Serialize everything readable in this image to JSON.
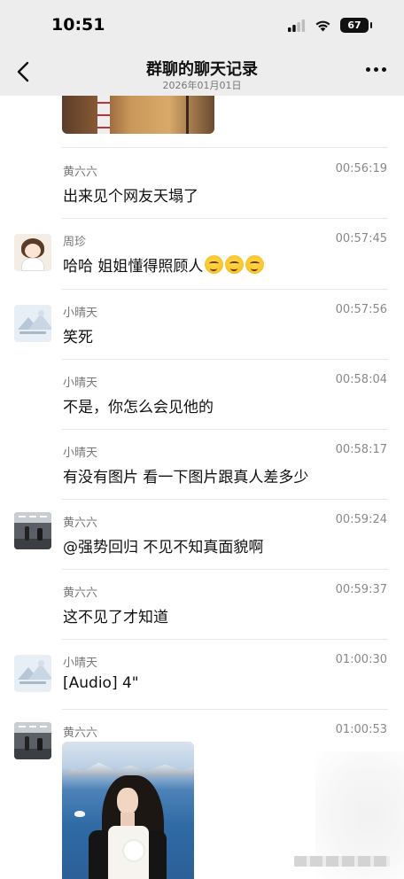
{
  "status_bar": {
    "time": "10:51",
    "battery": "67"
  },
  "header": {
    "title": "群聊的聊天记录",
    "subtitle": "2026年01月01日"
  },
  "messages": [
    {
      "sender": "黄六六",
      "time": "00:56:19",
      "text": "出来见个网友天塌了"
    },
    {
      "sender": "周珍",
      "time": "00:57:45",
      "text": "哈哈 姐姐懂得照顾人",
      "emoji_count": 3,
      "emoji_icon": "grimace-emoji-icon"
    },
    {
      "sender": "小晴天",
      "time": "00:57:56",
      "text": "笑死"
    },
    {
      "sender": "小晴天",
      "time": "00:58:04",
      "text": "不是，你怎么会见他的"
    },
    {
      "sender": "小晴天",
      "time": "00:58:17",
      "text": "有没有图片 看一下图片跟真人差多少"
    },
    {
      "sender": "黄六六",
      "time": "00:59:24",
      "text": "@强势回归 不见不知真面貌啊"
    },
    {
      "sender": "黄六六",
      "time": "00:59:37",
      "text": "这不见了才知道"
    },
    {
      "sender": "小晴天",
      "time": "01:00:30",
      "text": "[Audio] 4\""
    },
    {
      "sender": "黄六六",
      "time": "01:00:53",
      "text": ""
    }
  ],
  "icons": {
    "back": "chevron-left-icon",
    "more": "more-horizontal-icon",
    "signal": "cellular-signal-icon",
    "wifi": "wifi-icon"
  }
}
